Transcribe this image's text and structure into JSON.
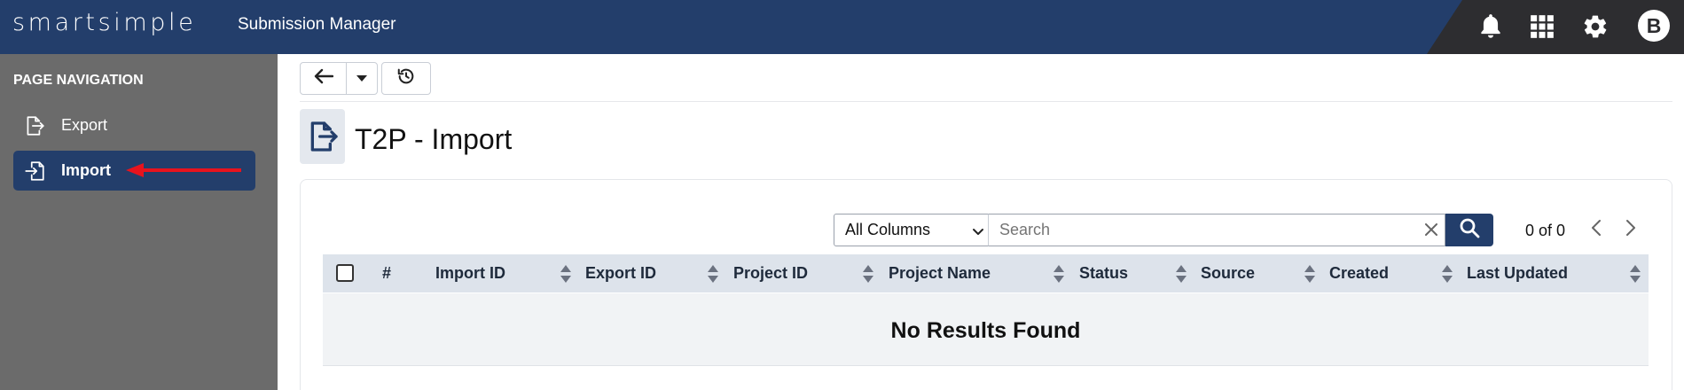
{
  "header": {
    "logo": "smartsimple",
    "app_title": "Submission Manager",
    "icons": [
      "bell-icon",
      "apps-grid-icon",
      "gear-icon"
    ],
    "avatar_initial": "B",
    "colors": {
      "primary": "#233e6b",
      "dark": "#2d2d30"
    }
  },
  "sidebar": {
    "heading": "PAGE NAVIGATION",
    "items": [
      {
        "label": "Export",
        "icon": "export-icon",
        "active": false
      },
      {
        "label": "Import",
        "icon": "import-icon",
        "active": true
      }
    ]
  },
  "toolbar": {
    "buttons": [
      "back-arrow-icon",
      "chevron-down-icon",
      "history-icon"
    ]
  },
  "page": {
    "title": "T2P - Import",
    "icon": "export-icon"
  },
  "filters": {
    "column_select": "All Columns",
    "search_placeholder": "Search",
    "search_value": "",
    "pager": "0 of 0"
  },
  "table": {
    "columns": [
      "#",
      "Import ID",
      "Export ID",
      "Project ID",
      "Project Name",
      "Status",
      "Source",
      "Created",
      "Last Updated"
    ],
    "empty_message": "No Results Found"
  }
}
